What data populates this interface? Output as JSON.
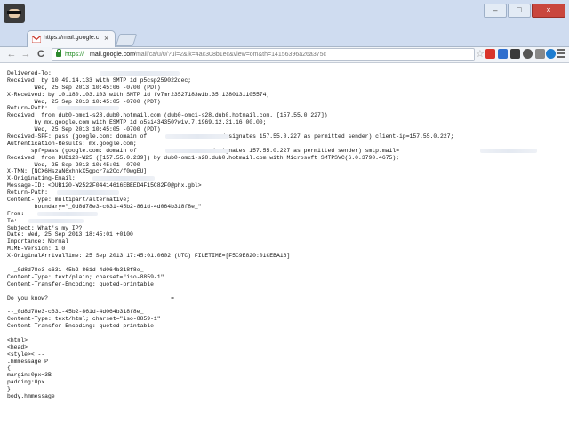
{
  "browser": {
    "tab_title": "https://mail.google.com/",
    "tab_close": "×",
    "url_protocol": "https://",
    "url_domain": "mail.google.com",
    "url_path": "/mail/ca/u/0/?ui=2&ik=4ac308b1ec&view=om&th=14156396a26a375c",
    "back_icon": "←",
    "forward_icon": "→",
    "reload_icon": "C",
    "bookmark_icon": "☆",
    "window_controls": {
      "minimize": "–",
      "maximize": "□",
      "close": "×"
    }
  },
  "colors": {
    "chrome_bg": "#cfdcf0",
    "url_secure": "#1f8a1f",
    "window_close": "#c9463d"
  },
  "icons": [
    "user-avatar-icon",
    "gmail-icon",
    "lock-icon",
    "star-icon",
    "extension-icons",
    "menu-icon"
  ],
  "source_lines": [
    "Delivered-To: ",
    "Received: by 10.49.14.133 with SMTP id p5csp259022qec;",
    "        Wed, 25 Sep 2013 10:45:06 -0700 (PDT)",
    "X-Received: by 10.180.103.103 with SMTP id fv7mr23527183wib.35.1380131105574;",
    "        Wed, 25 Sep 2013 10:45:05 -0700 (PDT)",
    "Return-Path: ",
    "Received: from dub0-omc1-s28.dub0.hotmail.com (dub0-omc1-s28.dub0.hotmail.com. [157.55.0.227])",
    "        by mx.google.com with ESMTP id o5si434350?wiv.7.1969.12.31.16.00.00;",
    "        Wed, 25 Sep 2013 10:45:05 -0700 (PDT)",
    "Received-SPF: pass (google.com: domain of                      designates 157.55.0.227 as permitted sender) client-ip=157.55.0.227;",
    "Authentication-Results: mx.google.com;",
    "       spf=pass (google.com: domain of                      designates 157.55.0.227 as permitted sender) smtp.mail=",
    "Received: from DUB120-W25 ([157.55.0.239]) by dub0-omc1-s28.dub0.hotmail.com with Microsoft SMTPSVC(6.0.3790.4675);",
    "        Wed, 25 Sep 2013 10:45:01 -0700",
    "X-TMN: [NCX6HszaN6xhnkX5gpcr7a2Cc/f0wgEU]",
    "X-Originating-Email: ",
    "Message-ID: <DUB120-W2522F04414616EBEED4F15C82F0@phx.gbl>",
    "Return-Path: ",
    "Content-Type: multipart/alternative;",
    "        boundary=\"_0d8d78e3-c631-45b2-861d-4d064b318f8e_\"",
    "From: ",
    "To: ",
    "Subject: What's my IP?",
    "Date: Wed, 25 Sep 2013 18:45:01 +0100",
    "Importance: Normal",
    "MIME-Version: 1.0",
    "X-OriginalArrivalTime: 25 Sep 2013 17:45:01.0602 (UTC) FILETIME=[F5C9E820:01CEBA16]",
    "",
    "--_0d8d78e3-c631-45b2-861d-4d064b318f8e_",
    "Content-Type: text/plain; charset=\"iso-8859-1\"",
    "Content-Transfer-Encoding: quoted-printable",
    "",
    "Do you know?                                    =",
    "",
    "--_0d8d78e3-c631-45b2-861d-4d064b318f8e_",
    "Content-Type: text/html; charset=\"iso-8859-1\"",
    "Content-Transfer-Encoding: quoted-printable",
    "",
    "<html>",
    "<head>",
    "<style><!--",
    ".hmmessage P",
    "{",
    "margin:0px=3B",
    "padding:0px",
    "}",
    "body.hmmessage"
  ]
}
